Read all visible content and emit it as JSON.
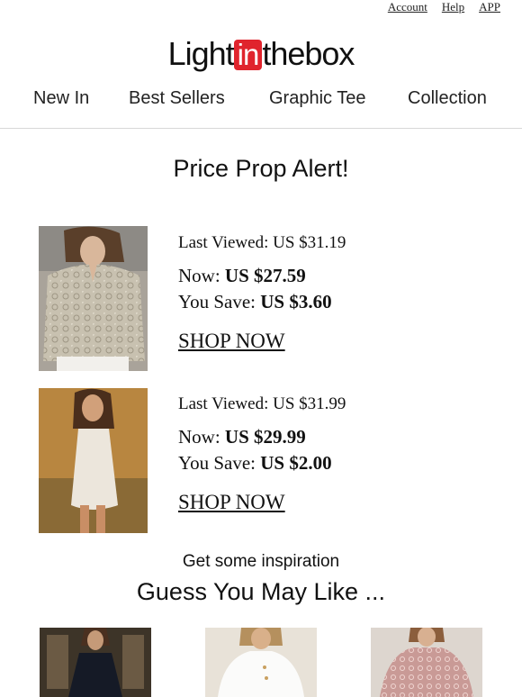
{
  "top_links": [
    "Account",
    "Help",
    "APP"
  ],
  "logo": {
    "left": "Light",
    "middle": "in",
    "right": "thebox"
  },
  "nav": [
    "New In",
    "Best Sellers",
    "Graphic Tee",
    "Collection"
  ],
  "title": "Price Prop Alert!",
  "products": [
    {
      "last_viewed_label": "Last Viewed: US $31.19",
      "now_label": "Now:",
      "now_price": "US $27.59",
      "save_label": "You Save:",
      "save_amount": "US $3.60",
      "cta": "SHOP NOW"
    },
    {
      "last_viewed_label": "Last Viewed: US $31.99",
      "now_label": "Now:",
      "now_price": "US $29.99",
      "save_label": "You Save:",
      "save_amount": "US $2.00",
      "cta": "SHOP NOW"
    }
  ],
  "inspiration": "Get some inspiration",
  "guess_title": "Guess You May Like ...",
  "colors": {
    "brand_red": "#e0242d"
  }
}
